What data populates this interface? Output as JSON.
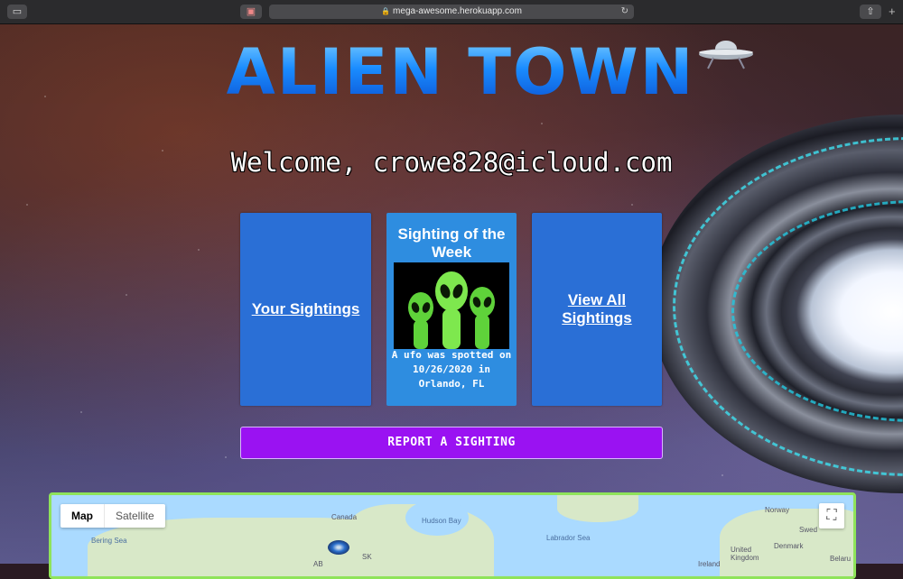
{
  "browser": {
    "url": "mega-awesome.herokuapp.com"
  },
  "header": {
    "logo_text": "ALIEN TOWN"
  },
  "welcome": {
    "text": "Welcome, crowe828@icloud.com"
  },
  "cards": {
    "your_sightings": "Your Sightings",
    "sighting_of_week_title": "Sighting of the Week",
    "sighting_caption": "A ufo was spotted on 10/26/2020 in Orlando, FL",
    "view_all": "View All Sightings"
  },
  "actions": {
    "report_label": "REPORT A SIGHTING"
  },
  "map": {
    "type_map": "Map",
    "type_satellite": "Satellite",
    "labels": {
      "canada": "Canada",
      "hudson_bay": "Hudson Bay",
      "labrador_sea": "Labrador Sea",
      "bering_sea": "Bering Sea",
      "norway": "Norway",
      "sweden": "Swed",
      "uk": "United Kingdom",
      "denmark": "Denmark",
      "ireland": "Ireland",
      "belarus": "Belaru",
      "sk": "SK",
      "ab": "AB"
    }
  },
  "colors": {
    "card_blue": "#2a6fd6",
    "report_purple": "#9a12f2",
    "map_border": "#8fe35a"
  }
}
